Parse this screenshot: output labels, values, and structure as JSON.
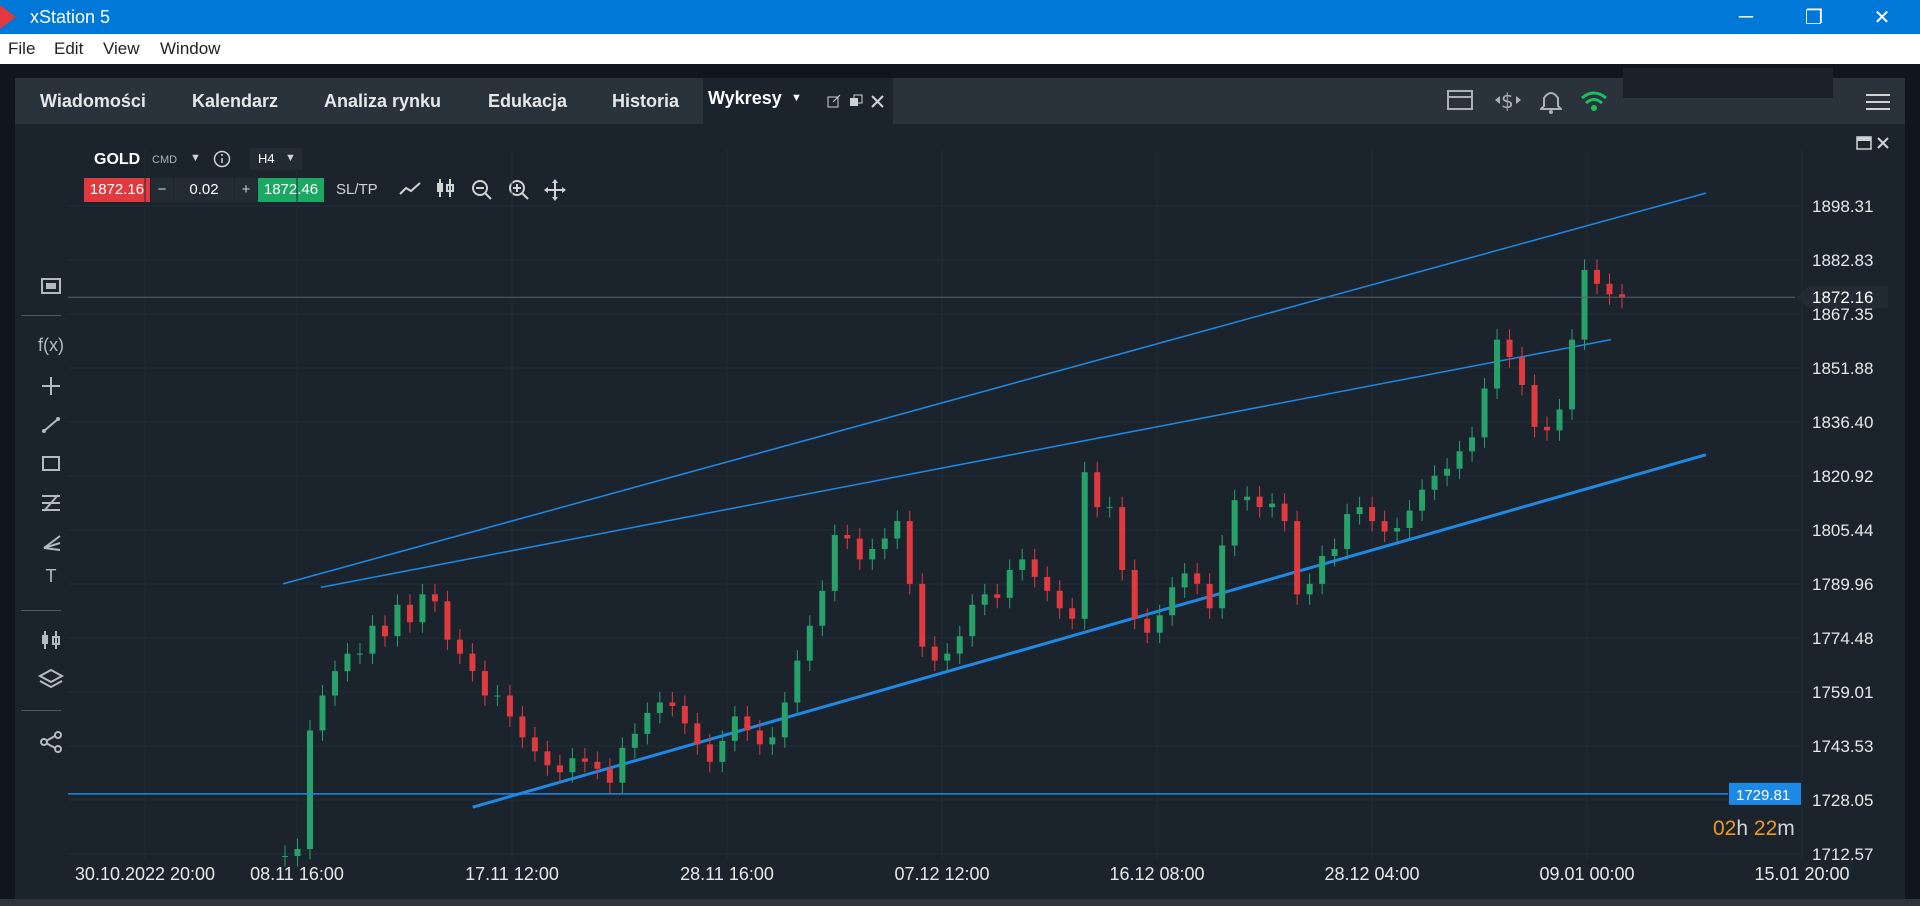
{
  "window": {
    "title": "xStation 5",
    "minimize": "─",
    "restore": "❐",
    "close": "✕"
  },
  "menu": [
    "File",
    "Edit",
    "View",
    "Window"
  ],
  "tabs": [
    "Wiadomości",
    "Kalendarz",
    "Analiza rynku",
    "Edukacja",
    "Historia"
  ],
  "active_tab": "Wykresy",
  "chart_header": {
    "symbol": "GOLD",
    "type": "CMD",
    "timeframe": "H4",
    "bid": "1872.16",
    "volume": "0.02",
    "ask": "1872.46",
    "sltp": "SL/TP",
    "minus": "−",
    "plus": "+",
    "bid_color": "#e0393e",
    "ask_color": "#1aa863"
  },
  "timer": {
    "h": "02",
    "m": "22",
    "h_unit": "h",
    "m_unit": "m"
  },
  "chart_data": {
    "type": "line",
    "title": "GOLD, H4",
    "x_labels": [
      "30.10.2022 20:00",
      "08.11 16:00",
      "17.11 12:00",
      "28.11 16:00",
      "07.12 12:00",
      "16.12 08:00",
      "28.12 04:00",
      "09.01 00:00",
      "15.01 20:00"
    ],
    "y_ticks": [
      "1898.31",
      "1882.83",
      "1867.35",
      "1851.88",
      "1836.40",
      "1820.92",
      "1805.44",
      "1789.96",
      "1774.48",
      "1759.01",
      "1743.53",
      "1728.05",
      "1712.57"
    ],
    "ylim": [
      1712.57,
      1898.31
    ],
    "current_price": "1872.16",
    "horizontal_level": "1729.81",
    "series": [
      {
        "values": [
          1712,
          1714,
          1748,
          1758,
          1765,
          1770,
          1770,
          1778,
          1775,
          1784,
          1779,
          1787,
          1785,
          1774,
          1770,
          1765,
          1758,
          1758,
          1752,
          1746,
          1742,
          1738,
          1736,
          1740,
          1739,
          1737,
          1733,
          1743,
          1747,
          1753,
          1756,
          1755,
          1750,
          1744,
          1739,
          1745,
          1752,
          1748,
          1744,
          1746,
          1756,
          1768,
          1778,
          1788,
          1804,
          1803,
          1797,
          1800,
          1803,
          1808,
          1790,
          1772,
          1768,
          1770,
          1775,
          1784,
          1787,
          1786,
          1794,
          1797,
          1792,
          1788,
          1783,
          1780,
          1822,
          1812,
          1812,
          1794,
          1780,
          1776,
          1781,
          1789,
          1793,
          1790,
          1783,
          1801,
          1814,
          1815,
          1812,
          1813,
          1808,
          1787,
          1790,
          1798,
          1800,
          1810,
          1812,
          1808,
          1805,
          1806,
          1811,
          1817,
          1821,
          1823,
          1828,
          1832,
          1846,
          1860,
          1855,
          1847,
          1835,
          1834,
          1840,
          1860,
          1880,
          1876,
          1873,
          1872
        ]
      }
    ],
    "trendlines": [
      {
        "name": "upper channel",
        "from": [
          "day 10",
          1790
        ],
        "to": [
          "day 85",
          1902
        ]
      },
      {
        "name": "middle line",
        "from": [
          "day 12",
          1789
        ],
        "to": [
          "day 80",
          1860
        ]
      },
      {
        "name": "lower channel",
        "from": [
          "day 20",
          1726
        ],
        "to": [
          "day 85",
          1827
        ]
      }
    ],
    "colors": {
      "up": "#26a269",
      "down": "#e0393e",
      "line": "#1e88e5"
    },
    "grid": true
  }
}
